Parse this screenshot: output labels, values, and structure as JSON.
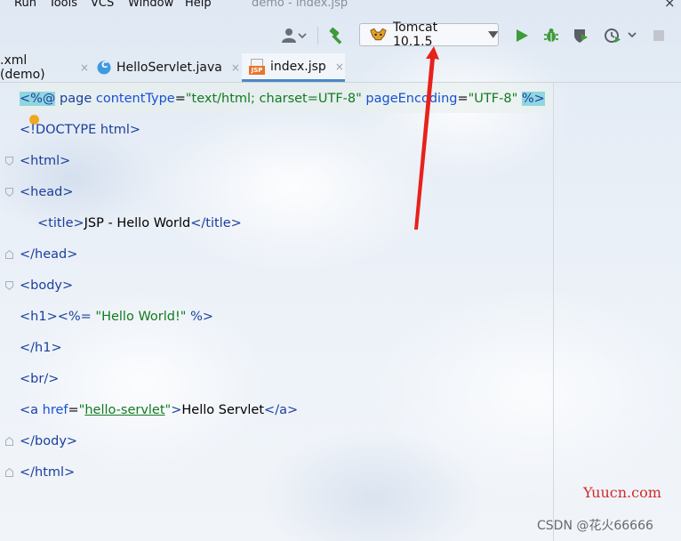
{
  "menu": {
    "items": [
      "Run",
      "Tools",
      "VCS",
      "Window",
      "Help"
    ]
  },
  "window": {
    "title": "demo - index.jsp",
    "close_glyph": "×"
  },
  "toolbar": {
    "run_config": "Tomcat 10.1.5",
    "icons": [
      "user-icon",
      "build-hammer-icon",
      "tomcat-icon",
      "chevron-down-icon",
      "run-icon",
      "debug-icon",
      "coverage-icon",
      "profile-icon",
      "stop-icon"
    ]
  },
  "tabs": [
    {
      "label": ".xml (demo)",
      "close": "×",
      "active": false
    },
    {
      "label": "HelloServlet.java",
      "close": "×",
      "active": false,
      "icon_letter": "C"
    },
    {
      "label": "index.jsp",
      "close": "×",
      "active": true,
      "icon_text": "JSP"
    }
  ],
  "code": {
    "l1": {
      "open": "<%@",
      "kw": "page",
      "a1": "contentType",
      "eq1": "=",
      "v1": "\"text/html; charset=UTF-8\"",
      "a2": "pageEncoding",
      "eq2": "=",
      "v2": "\"UTF-8\"",
      "close": "%>"
    },
    "l2": {
      "t": "<!DOCTYPE html>"
    },
    "l3": {
      "t": "<html>"
    },
    "l4": {
      "t": "<head>"
    },
    "l5": {
      "open": "<title>",
      "text": "JSP - Hello World",
      "close": "</title>"
    },
    "l6": {
      "t": "</head>"
    },
    "l7": {
      "t": "<body>"
    },
    "l8": {
      "open": "<h1>",
      "jopen": "<%=",
      "str": "\"Hello World!\"",
      "jclose": "%>"
    },
    "l9": {
      "t": "</h1>"
    },
    "l10": {
      "t": "<br/>"
    },
    "l11": {
      "open": "<a ",
      "attr": "href",
      "eq": "=",
      "q1": "\"",
      "href": "hello-servlet",
      "q2": "\"",
      "gt": ">",
      "text": "Hello Servlet",
      "close": "</a>"
    },
    "l12": {
      "t": "</body>"
    },
    "l13": {
      "t": "</html>"
    }
  },
  "watermark": {
    "site": "Yuucn.com",
    "author": "CSDN @花火66666"
  },
  "colors": {
    "accent_tab": "#4a88c7",
    "run_green": "#3f9b3a",
    "annotation_arrow": "#e8211b"
  }
}
